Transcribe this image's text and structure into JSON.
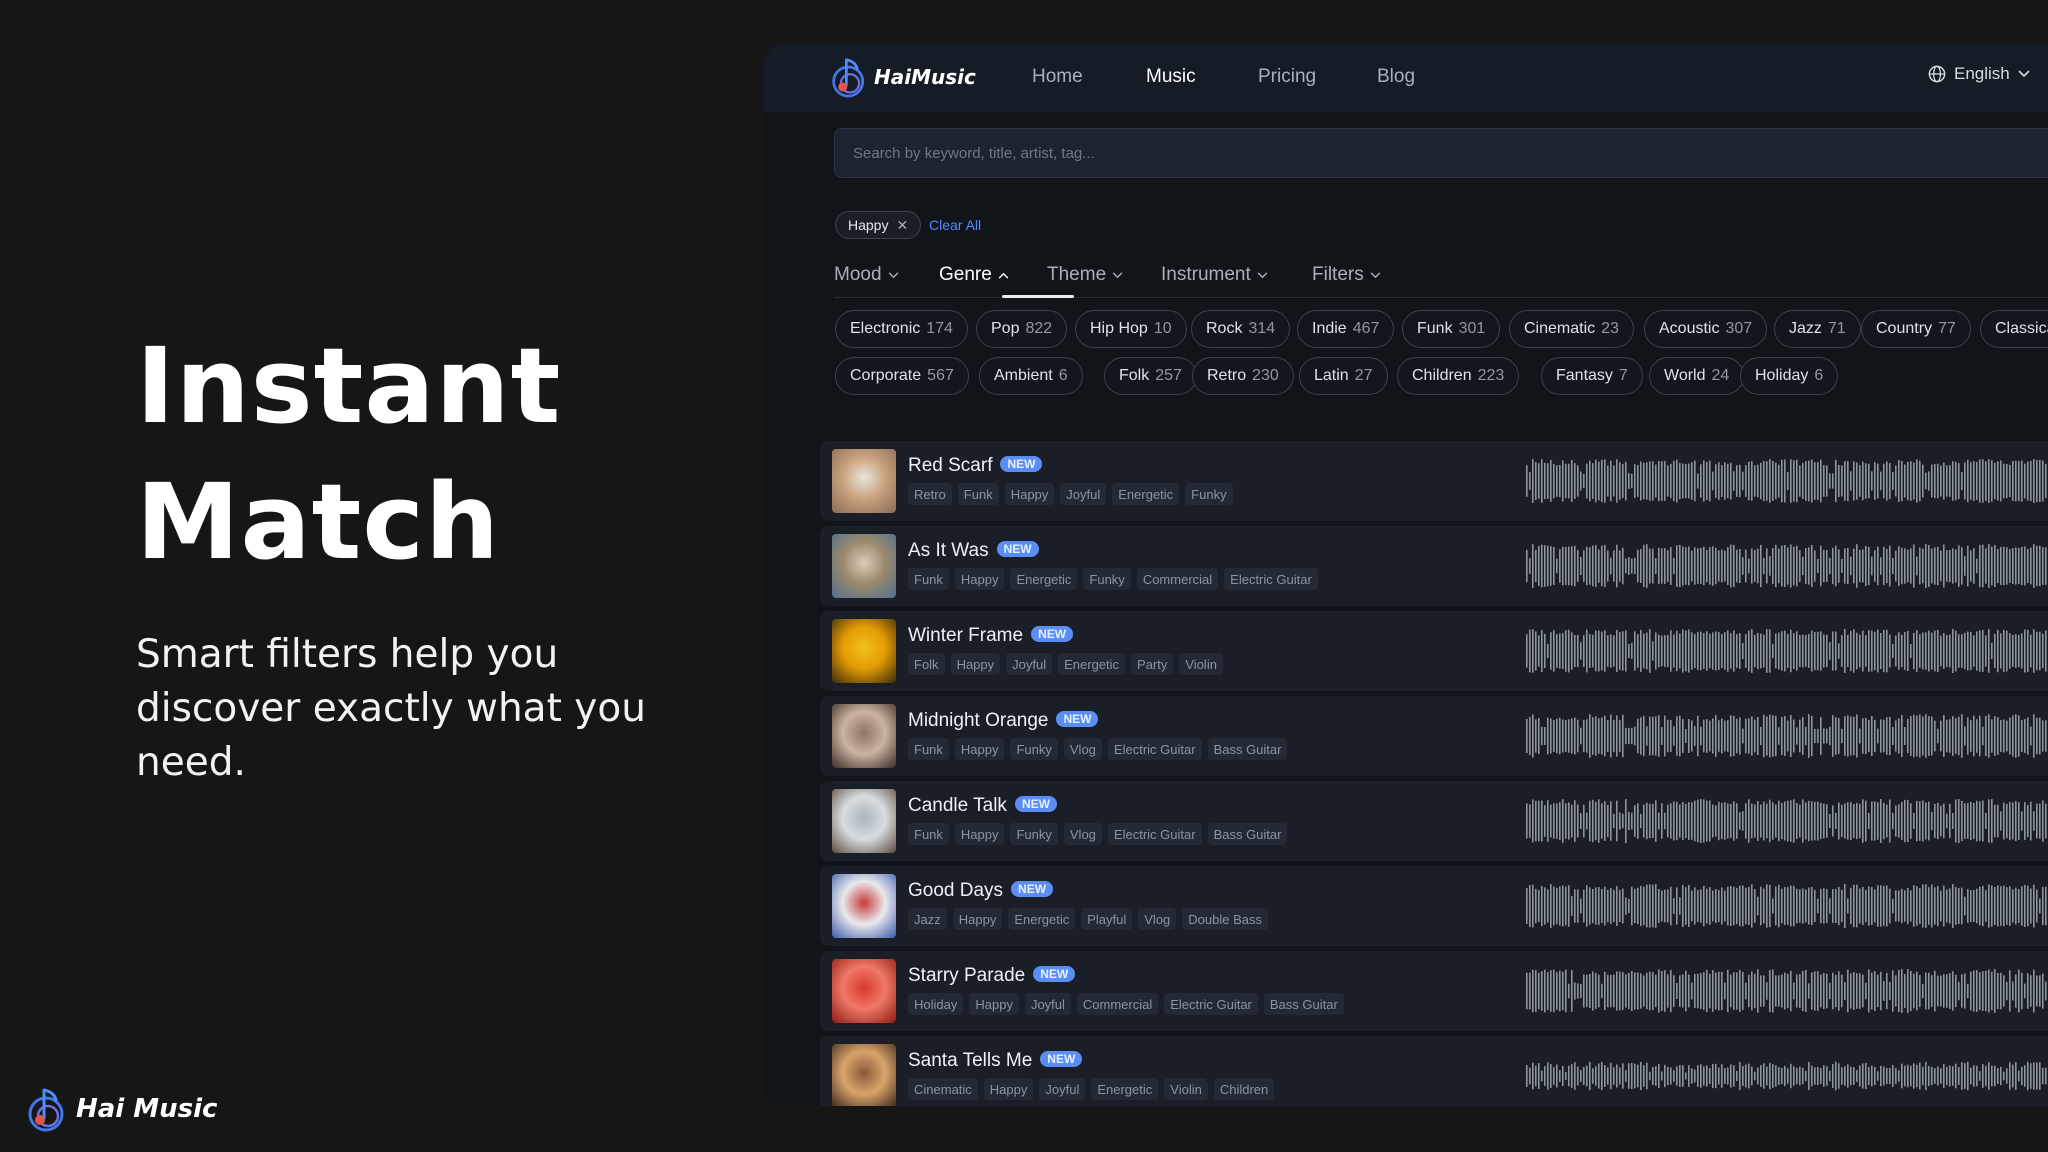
{
  "hero": {
    "title_line1": "Instant",
    "title_line2": "Match",
    "subtitle": "Smart filters help you discover exactly what you need."
  },
  "brand": {
    "name": "Hai Music"
  },
  "app": {
    "logo_name": "HaiMusic",
    "nav": [
      "Home",
      "Music",
      "Pricing",
      "Blog"
    ],
    "active_nav": "Music",
    "language": "English",
    "search_placeholder": "Search by keyword, title, artist, tag...",
    "active_filter": "Happy",
    "clear_all": "Clear All",
    "category_tabs": [
      {
        "label": "Mood",
        "chevron": "down"
      },
      {
        "label": "Genre",
        "chevron": "up",
        "active": true
      },
      {
        "label": "Theme",
        "chevron": "down"
      },
      {
        "label": "Instrument",
        "chevron": "down"
      },
      {
        "label": "Filters",
        "chevron": "down"
      }
    ],
    "genres_row1": [
      {
        "name": "Electronic",
        "count": "174"
      },
      {
        "name": "Pop",
        "count": "822"
      },
      {
        "name": "Hip Hop",
        "count": "10"
      },
      {
        "name": "Rock",
        "count": "314"
      },
      {
        "name": "Indie",
        "count": "467"
      },
      {
        "name": "Funk",
        "count": "301"
      },
      {
        "name": "Cinematic",
        "count": "23"
      },
      {
        "name": "Acoustic",
        "count": "307"
      },
      {
        "name": "Jazz",
        "count": "71"
      },
      {
        "name": "Country",
        "count": "77"
      },
      {
        "name": "Classica",
        "count": ""
      }
    ],
    "genres_row2": [
      {
        "name": "Corporate",
        "count": "567"
      },
      {
        "name": "Ambient",
        "count": "6"
      },
      {
        "name": "Folk",
        "count": "257"
      },
      {
        "name": "Retro",
        "count": "230"
      },
      {
        "name": "Latin",
        "count": "27"
      },
      {
        "name": "Children",
        "count": "223"
      },
      {
        "name": "Fantasy",
        "count": "7"
      },
      {
        "name": "World",
        "count": "24"
      },
      {
        "name": "Holiday",
        "count": "6"
      }
    ],
    "new_badge": "NEW",
    "tracks": [
      {
        "title": "Red Scarf",
        "tags": [
          "Retro",
          "Funk",
          "Happy",
          "Joyful",
          "Energetic",
          "Funky"
        ],
        "thumb": [
          "#e9e4dc",
          "#c9a27e",
          "#8a6b55"
        ]
      },
      {
        "title": "As It Was",
        "tags": [
          "Funk",
          "Happy",
          "Energetic",
          "Funky",
          "Commercial",
          "Electric Guitar"
        ],
        "thumb": [
          "#d8cdb9",
          "#9c8a6c",
          "#4f6e8f"
        ]
      },
      {
        "title": "Winter Frame",
        "tags": [
          "Folk",
          "Happy",
          "Joyful",
          "Energetic",
          "Party",
          "Violin"
        ],
        "thumb": [
          "#f2c21a",
          "#e39b05",
          "#3a2a0a"
        ]
      },
      {
        "title": "Midnight Orange",
        "tags": [
          "Funk",
          "Happy",
          "Funky",
          "Vlog",
          "Electric Guitar",
          "Bass Guitar"
        ],
        "thumb": [
          "#8d7467",
          "#cbb3a1",
          "#3a2a24"
        ]
      },
      {
        "title": "Candle Talk",
        "tags": [
          "Funk",
          "Happy",
          "Funky",
          "Vlog",
          "Electric Guitar",
          "Bass Guitar"
        ],
        "thumb": [
          "#a8b4bd",
          "#d9dde0",
          "#5b4b40"
        ]
      },
      {
        "title": "Good Days",
        "tags": [
          "Jazz",
          "Happy",
          "Energetic",
          "Playful",
          "Vlog",
          "Double Bass"
        ],
        "thumb": [
          "#c63a3a",
          "#e9e9ec",
          "#3a5aa8"
        ]
      },
      {
        "title": "Starry Parade",
        "tags": [
          "Holiday",
          "Happy",
          "Joyful",
          "Commercial",
          "Electric Guitar",
          "Bass Guitar"
        ],
        "thumb": [
          "#d73a32",
          "#f07866",
          "#8c1a14"
        ]
      },
      {
        "title": "Santa Tells Me",
        "tags": [
          "Cinematic",
          "Happy",
          "Joyful",
          "Energetic",
          "Violin",
          "Children"
        ],
        "thumb": [
          "#8a5a3a",
          "#d9a46a",
          "#3a2418"
        ]
      }
    ]
  },
  "colors": {
    "accent": "#5b8ef5",
    "link": "#4d8dff",
    "row_bg": "#1a1f27",
    "page_bg": "#161616"
  }
}
